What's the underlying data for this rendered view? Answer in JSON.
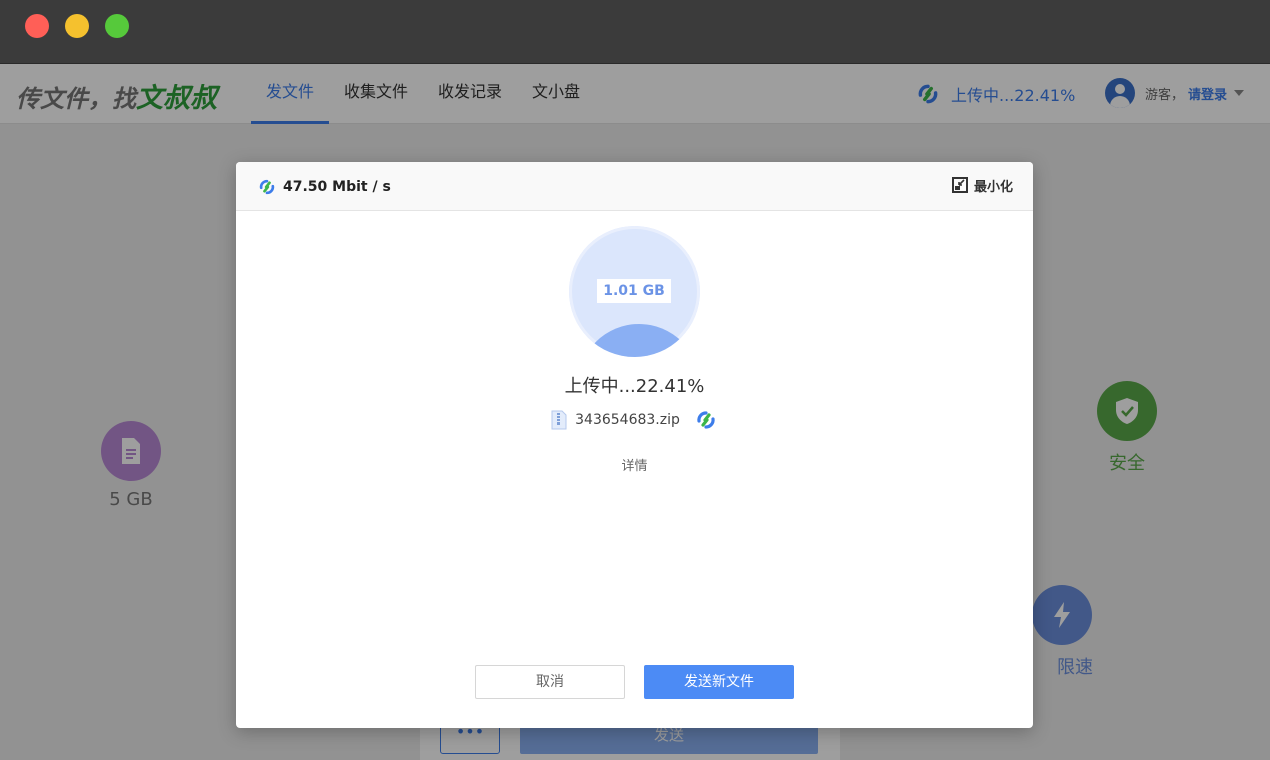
{
  "window": {
    "traffic_lights": [
      "close",
      "minimize",
      "zoom"
    ]
  },
  "header": {
    "brand_prefix": "传文件，找",
    "brand_accent": "文叔叔",
    "nav": [
      {
        "label": "发文件",
        "active": true
      },
      {
        "label": "收集文件",
        "active": false
      },
      {
        "label": "收发记录",
        "active": false
      },
      {
        "label": "文小盘",
        "active": false
      }
    ],
    "upload_status": "上传中...22.41%",
    "user": {
      "guest_label": "游客，",
      "login_label": "请登录"
    }
  },
  "background": {
    "feature_size": {
      "label": "5 GB",
      "icon": "file-icon",
      "color": "#b98ad6"
    },
    "feature_secure": {
      "label": "安全",
      "icon": "shield-check-icon",
      "color": "#5aa84a"
    },
    "feature_speed": {
      "label": "限速",
      "icon": "lightning-icon",
      "color": "#6b8fdc"
    },
    "more_label": "•••",
    "send_label": "发送"
  },
  "modal": {
    "speed": "47.50 Mbit / s",
    "minimize_label": "最小化",
    "total_size": "1.01 GB",
    "progress_percent": 22.41,
    "status": "上传中...22.41%",
    "file_name": "343654683.zip",
    "details_label": "详情",
    "cancel_label": "取消",
    "send_new_label": "发送新文件"
  },
  "colors": {
    "accent": "#3d7dea",
    "brand_green": "#2e9e3b",
    "progress_fill": "#8aaff3",
    "progress_bg": "#dbe6fc",
    "primary_button": "#4c8bf5"
  }
}
